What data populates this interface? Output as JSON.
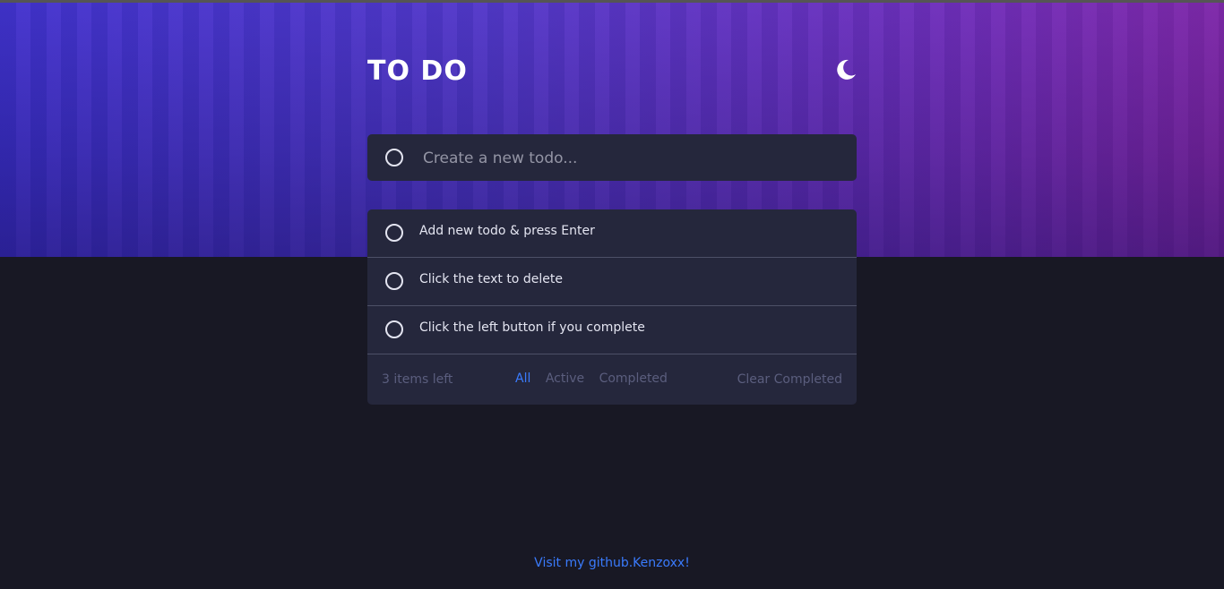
{
  "header": {
    "title": "TO DO",
    "theme_icon": "moon-icon"
  },
  "new_todo": {
    "placeholder": "Create a new todo..."
  },
  "todos": [
    {
      "text": "Add new todo & press Enter",
      "completed": false
    },
    {
      "text": "Click the text to delete",
      "completed": false
    },
    {
      "text": "Click the left button if you complete",
      "completed": false
    }
  ],
  "footer": {
    "items_left": "3 items left",
    "filters": [
      "All",
      "Active",
      "Completed"
    ],
    "active_filter": "All",
    "clear_label": "Clear Completed"
  },
  "credit": {
    "text": "Visit my github.Kenzoxx!"
  },
  "colors": {
    "accent": "#3a7bfd",
    "card_bg": "#25273c",
    "page_bg": "#181824"
  }
}
